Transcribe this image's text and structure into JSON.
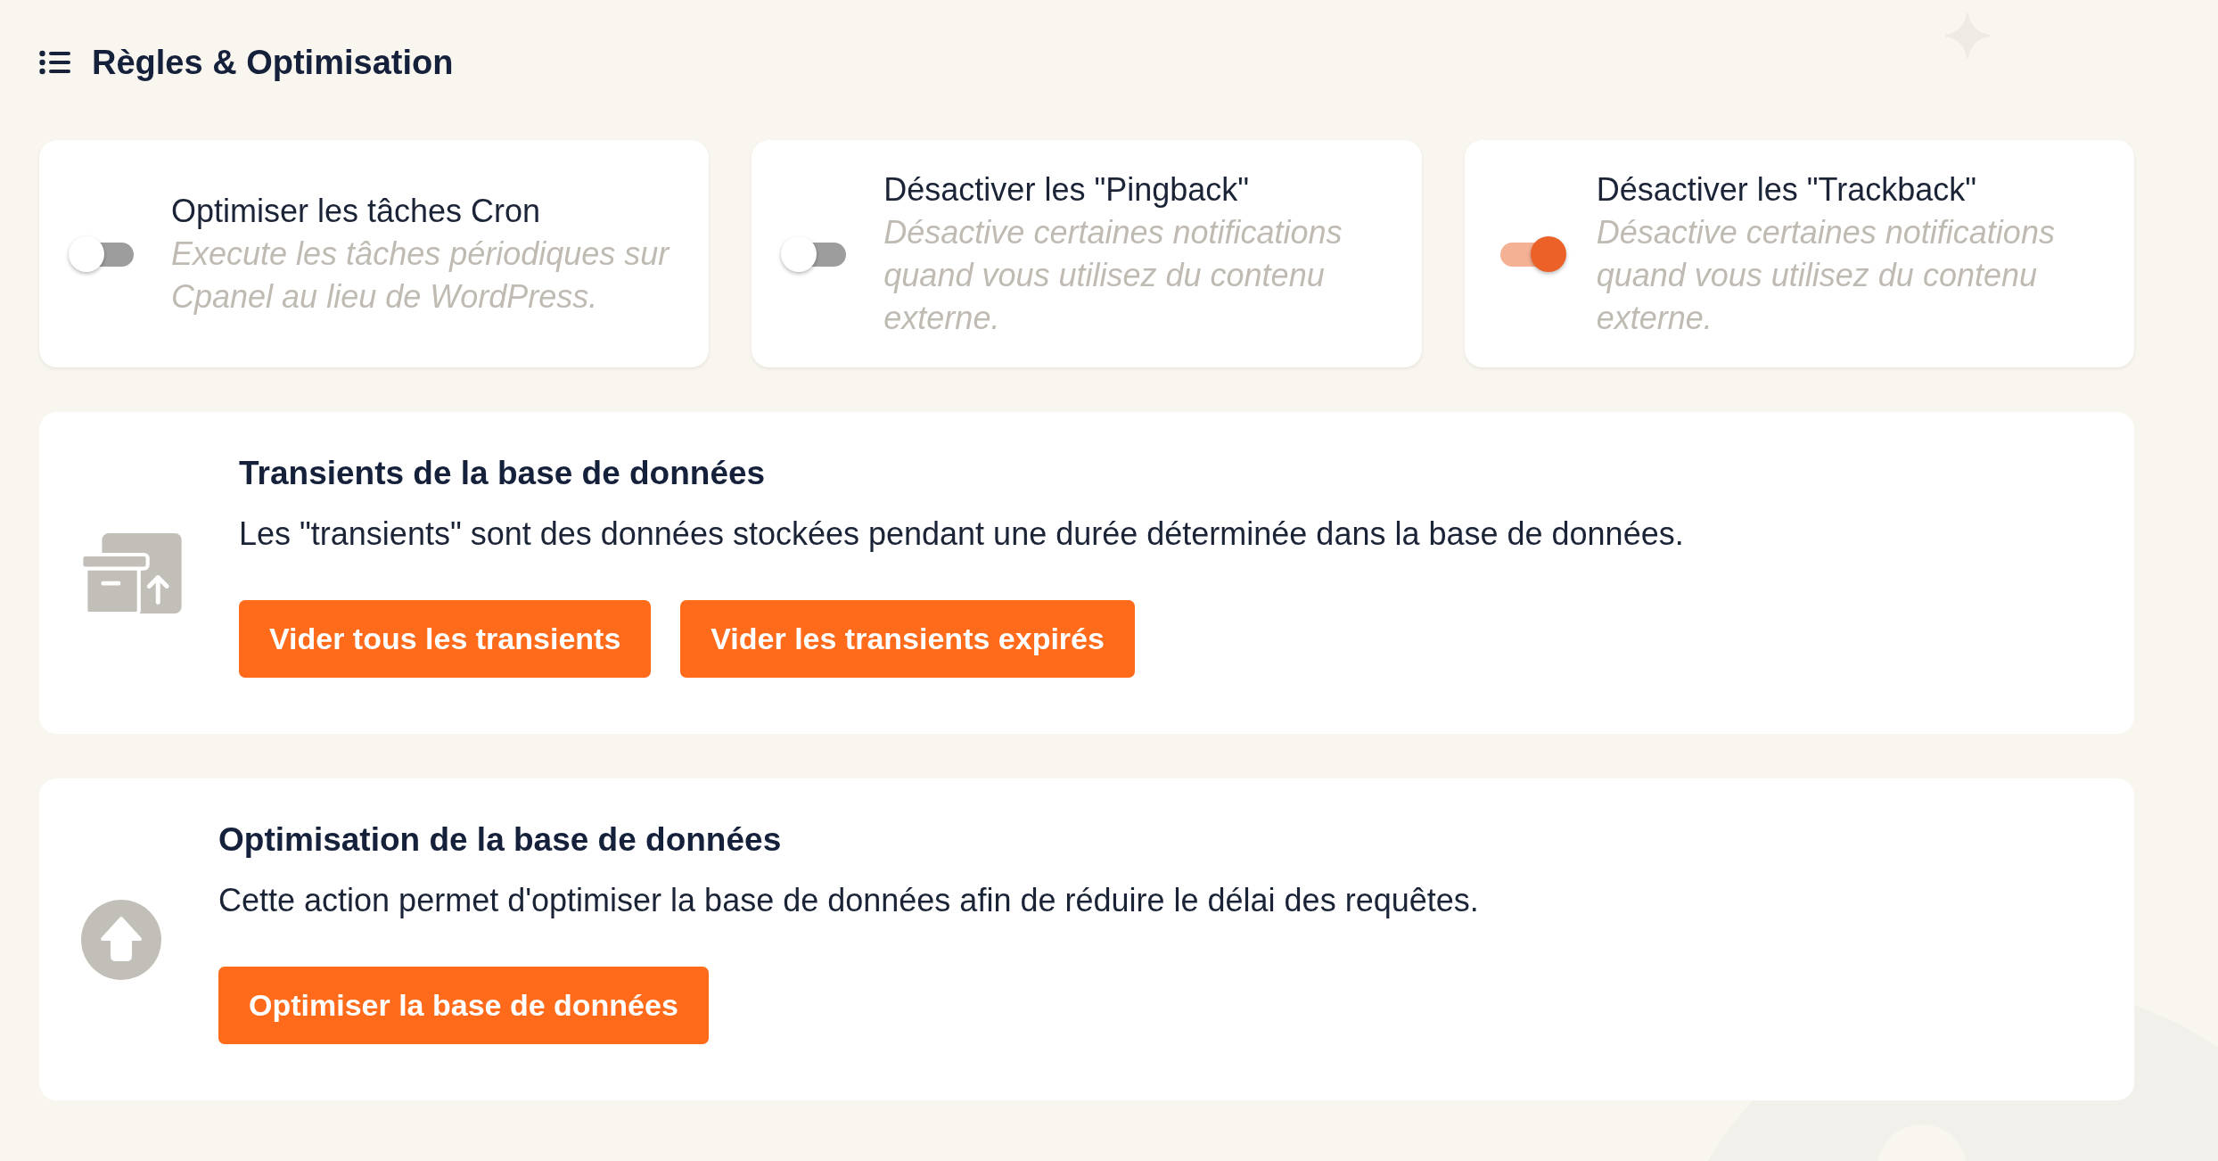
{
  "header": {
    "title": "Règles & Optimisation"
  },
  "toggles": [
    {
      "title": "Optimiser les tâches Cron",
      "description": "Execute les tâches périodiques sur Cpanel au lieu de WordPress.",
      "on": false
    },
    {
      "title": "Désactiver les \"Pingback\"",
      "description": "Désactive certaines notifications quand vous utilisez du contenu externe.",
      "on": false
    },
    {
      "title": "Désactiver les \"Trackback\"",
      "description": "Désactive certaines notifications quand vous utilisez du contenu externe.",
      "on": true
    }
  ],
  "actions": [
    {
      "kind": "archive",
      "title": "Transients de la base de données",
      "description": "Les \"transients\" sont des données stockées pendant une durée déterminée dans la base de données.",
      "buttons": [
        "Vider tous les transients",
        "Vider les transients expirés"
      ]
    },
    {
      "kind": "upload",
      "title": "Optimisation de la base de données",
      "description": "Cette action permet d'optimiser la base de données afin de réduire le délai des requêtes.",
      "buttons": [
        "Optimiser la base de données"
      ]
    }
  ]
}
